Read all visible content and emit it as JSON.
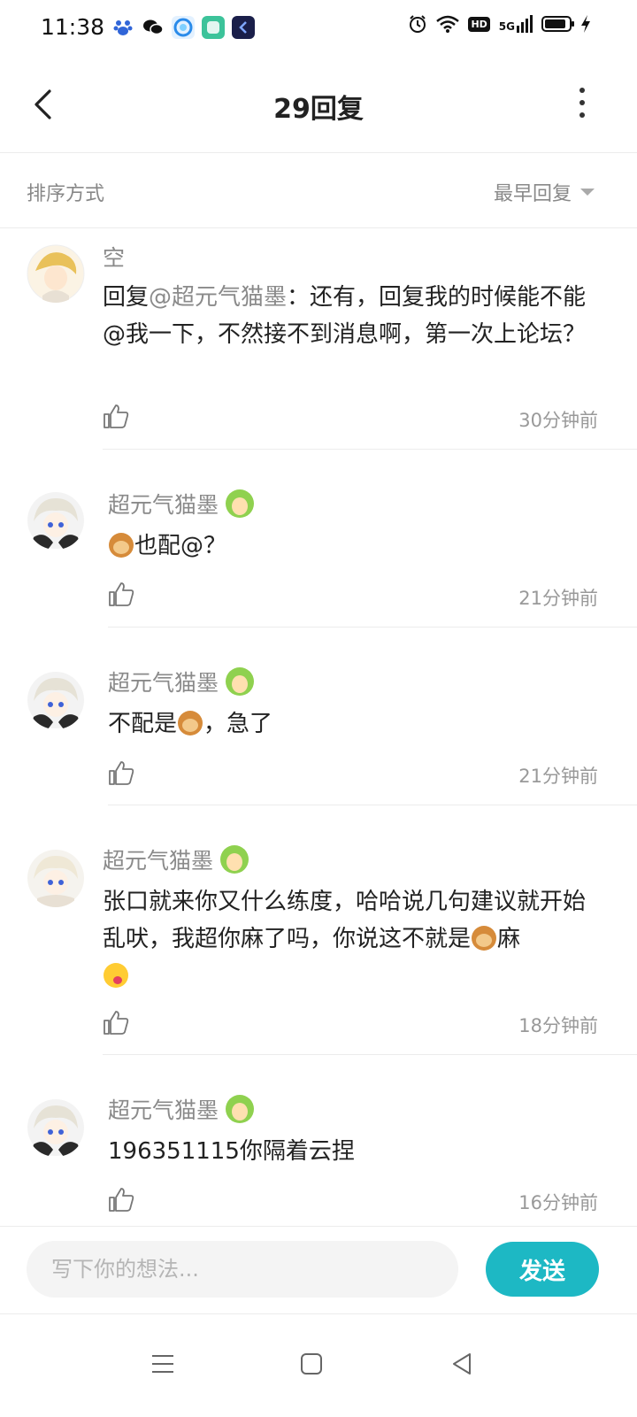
{
  "status_bar": {
    "time": "11:38",
    "network": "5G",
    "hd": "HD",
    "battery_level": 0.9,
    "app_icons": [
      "baidu-icon",
      "wechat-icon",
      "browser-icon",
      "notes-app-icon",
      "app-icon"
    ]
  },
  "header": {
    "title": "29回复"
  },
  "sort": {
    "label": "排序方式",
    "value": "最早回复"
  },
  "replies": [
    {
      "user": "空",
      "text_prefix": "回复",
      "mention": "@超元气猫墨",
      "text": "：还有，回复我的时候能不能@我一下，不然接不到消息啊，第一次上论坛？",
      "time": "30分钟前"
    },
    {
      "user": "超元气猫墨",
      "text_after_emoji": "也配@？",
      "time": "21分钟前"
    },
    {
      "user": "超元气猫墨",
      "text_before_emoji": "不配是",
      "text_after_emoji": "，急了",
      "time": "21分钟前"
    },
    {
      "user": "超元气猫墨",
      "text_before_emoji": "张口就来你又什么练度，哈哈说几句建议就开始乱吠，我超你麻了吗，你说这不就是",
      "text_after_emoji": "麻",
      "time": "18分钟前"
    },
    {
      "user": "超元气猫墨",
      "text": "196351115你隔着云捏",
      "time": "16分钟前"
    }
  ],
  "composer": {
    "placeholder": "写下你的想法...",
    "send_label": "发送"
  },
  "colors": {
    "accent": "#1db8c4",
    "secondary_text": "#8a8a8a",
    "divider": "#ececec"
  }
}
